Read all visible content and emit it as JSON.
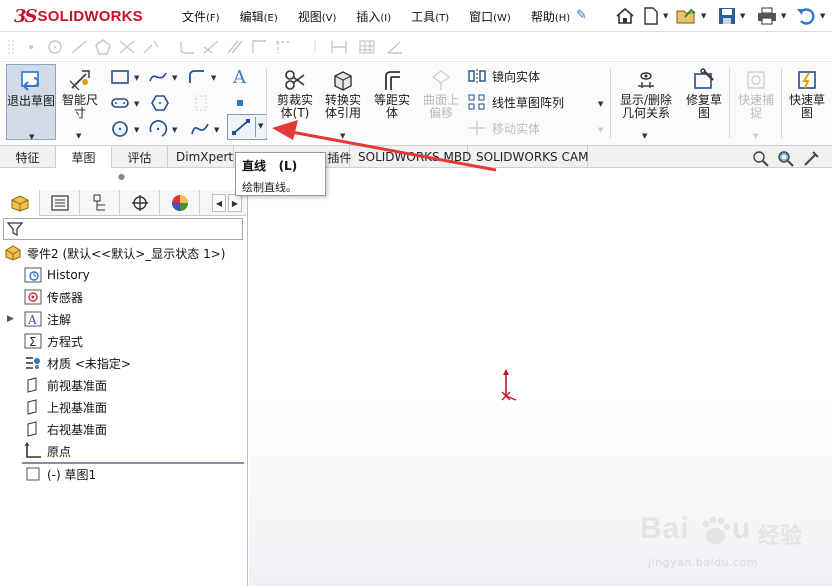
{
  "app": {
    "logo_ds": "3S",
    "logo_text": "SOLIDWORKS"
  },
  "menus": [
    {
      "label": "文件",
      "key": "(F)"
    },
    {
      "label": "编辑",
      "key": "(E)"
    },
    {
      "label": "视图",
      "key": "(V)"
    },
    {
      "label": "插入",
      "key": "(I)"
    },
    {
      "label": "工具",
      "key": "(T)"
    },
    {
      "label": "窗口",
      "key": "(W)"
    },
    {
      "label": "帮助",
      "key": "(H)"
    }
  ],
  "ribbon": {
    "exit_sketch": "退出草图",
    "smart_dim_l1": "智能尺",
    "smart_dim_l2": "寸",
    "trim_l1": "剪裁实",
    "trim_l2": "体(T)",
    "convert_l1": "转换实",
    "convert_l2": "体引用",
    "offset_l1": "等距实",
    "offset_l2": "体",
    "surface_l1": "曲面上",
    "surface_l2": "偏移",
    "mirror": "镜向实体",
    "linear_pattern": "线性草图阵列",
    "move": "移动实体",
    "display_l1": "显示/删除",
    "display_l2": "几何关系",
    "repair_l1": "修复草",
    "repair_l2": "图",
    "snap_l1": "快速捕",
    "snap_l2": "捉",
    "rapid_l1": "快速草",
    "rapid_l2": "图"
  },
  "tabs": [
    "特征",
    "草图",
    "评估",
    "DimXpert",
    "SOLIDWORKS 插件",
    "SOLIDWORKS MBD",
    "SOLIDWORKS CAM"
  ],
  "tooltip": {
    "title": "直线",
    "shortcut": "(L)",
    "description": "绘制直线。"
  },
  "tree": {
    "part": "零件2 (默认<<默认>_显示状态 1>)",
    "items": [
      {
        "label": "History",
        "icon": "history-icon"
      },
      {
        "label": "传感器",
        "icon": "sensor-icon"
      },
      {
        "label": "注解",
        "icon": "annotation-icon"
      },
      {
        "label": "方程式",
        "icon": "equation-icon"
      },
      {
        "label": "材质 <未指定>",
        "icon": "material-icon"
      },
      {
        "label": "前视基准面",
        "icon": "plane-icon"
      },
      {
        "label": "上视基准面",
        "icon": "plane-icon"
      },
      {
        "label": "右视基准面",
        "icon": "plane-icon"
      },
      {
        "label": "原点",
        "icon": "origin-icon"
      }
    ],
    "sketch": "(-) 草图1"
  },
  "watermark": {
    "brand": "Bai",
    "cn": "经验",
    "url": "jingyan.baidu.com"
  },
  "colors": {
    "accent": "#c8102e",
    "annotation_arrow": "#e53935",
    "selection_blue": "#2f75c9"
  }
}
